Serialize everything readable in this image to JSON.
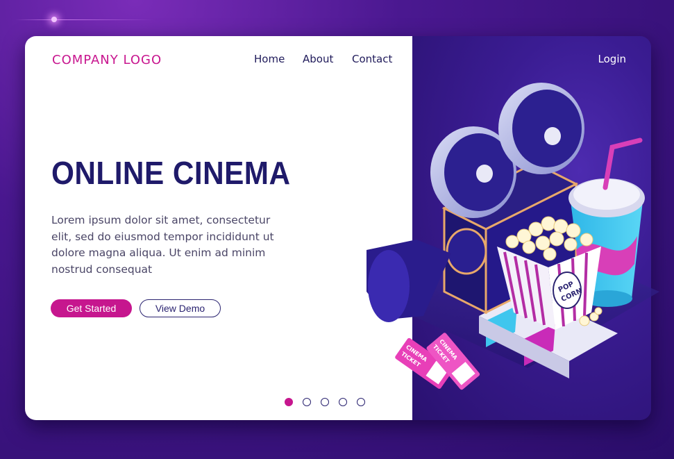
{
  "header": {
    "logo": "COMPANY LOGO",
    "nav": [
      {
        "label": "Home"
      },
      {
        "label": "About"
      },
      {
        "label": "Contact"
      }
    ],
    "login": "Login"
  },
  "hero": {
    "title": "ONLINE CINEMA",
    "description": "Lorem ipsum dolor sit amet, consectetur elit, sed do eiusmod tempor incididunt ut dolore magna aliqua. Ut enim ad minim nostrud consequat",
    "primary_button": "Get Started",
    "secondary_button": "View Demo"
  },
  "carousel": {
    "slide_count": 5,
    "active_slide": 1
  },
  "illustration": {
    "popcorn_text": "POP CORN",
    "ticket_text": "CINEMA TICKET"
  },
  "colors": {
    "accent": "#c6168e",
    "navy": "#1f1a6a",
    "background": "#3a1c92"
  }
}
